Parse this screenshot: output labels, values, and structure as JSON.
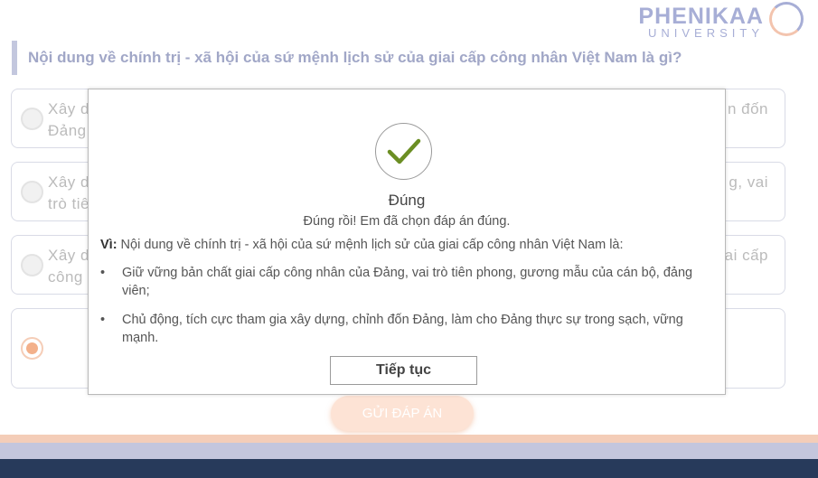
{
  "brand": {
    "name": "PHENIKAA",
    "sub": "UNIVERSITY"
  },
  "question": {
    "text": "Nội dung về chính trị - xã hội của sứ mệnh lịch sử của giai cấp công nhân Việt Nam là gì?"
  },
  "options": [
    {
      "left": "Xây d\nĐảng",
      "right": "n đốn"
    },
    {
      "left": "Xây d\ntrò tiê",
      "right": "g, vai"
    },
    {
      "left": "Xây d\ncông",
      "right": "ai cấp"
    },
    {
      "left": "",
      "right": ""
    }
  ],
  "submit": {
    "label": "GỬI ĐÁP ÁN"
  },
  "modal": {
    "title": "Đúng",
    "message": "Đúng rồi! Em đã chọn đáp án đúng.",
    "intro_label": "Vì:",
    "intro_text": " Nội dung về chính trị - xã hội của sứ mệnh lịch sử của giai cấp công nhân Việt Nam là:",
    "bullet_symbol": "•",
    "bullets": [
      "Giữ vững bản chất giai cấp công nhân của Đảng, vai trò tiên phong, gương mẫu của cán bộ, đảng viên;",
      "Chủ động, tích cực tham gia xây dựng, chỉnh đốn Đảng, làm cho Đảng thực sự trong sạch, vững mạnh."
    ],
    "continue_label": "Tiếp tục"
  },
  "colors": {
    "accent_lavender": "#a7aed6",
    "accent_peach": "#f3b08a",
    "check_green": "#6b8e23",
    "footer_navy": "#273a5b"
  },
  "icons": {
    "check": "check-icon",
    "radio": "radio-icon",
    "logo": "logo-ring-icon"
  }
}
